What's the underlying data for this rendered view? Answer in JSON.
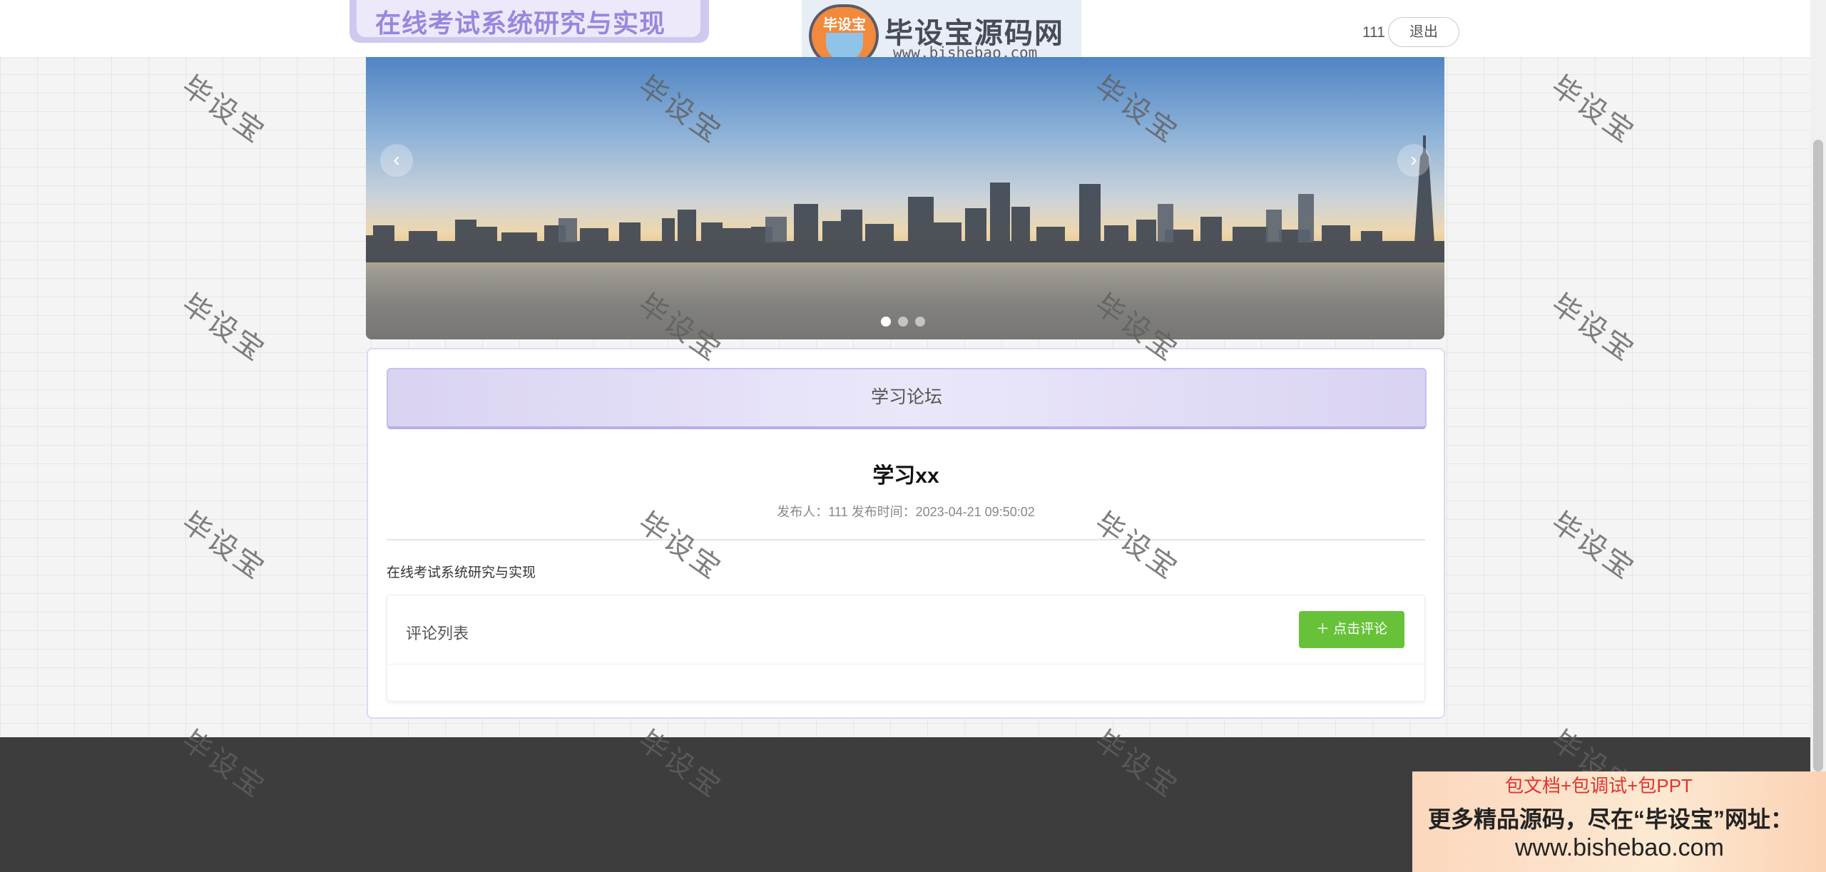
{
  "header": {
    "site_title": "在线考试系统研究与实现",
    "logo_badge": "毕设宝",
    "logo_name": "毕设宝源码网",
    "logo_url": "www.bishebao.com",
    "username": "111",
    "logout_label": "退出"
  },
  "carousel": {
    "prev_icon": "‹",
    "next_icon": "›",
    "slide_count": 3,
    "active_index": 0
  },
  "forum": {
    "header_title": "学习论坛",
    "post": {
      "title": "学习xx",
      "meta": "发布人：111  发布时间：2023-04-21 09:50:02",
      "content": "在线考试系统研究与实现"
    },
    "comments": {
      "title": "评论列表",
      "add_button": "＋ 点击评论"
    }
  },
  "watermark": "毕设宝",
  "promo": {
    "line1": "包文档+包调试+包PPT",
    "line2": "更多精品源码，尽在“毕设宝”网址：",
    "line3": "www.bishebao.com"
  },
  "colors": {
    "accent_purple": "#9a86dd",
    "comment_button_green": "#67c23a",
    "footer_dark": "#3d3d3d",
    "promo_red": "#e0352f"
  }
}
